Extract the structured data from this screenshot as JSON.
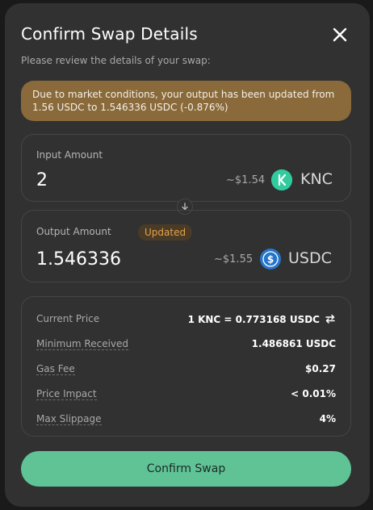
{
  "dialog": {
    "title": "Confirm Swap Details",
    "subtitle": "Please review the details of your swap:",
    "warning": "Due to market conditions, your output has been updated from 1.56 USDC to 1.546336 USDC (-0.876%)"
  },
  "input": {
    "label": "Input Amount",
    "amount": "2",
    "usd": "~$1.54",
    "token": "KNC",
    "token_color": "#31cb9e"
  },
  "output": {
    "label": "Output Amount",
    "badge": "Updated",
    "amount": "1.546336",
    "usd": "~$1.55",
    "token": "USDC",
    "token_color": "#2775ca"
  },
  "details": {
    "current_price_label": "Current Price",
    "current_price_value": "1 KNC = 0.773168 USDC",
    "min_received_label": "Minimum Received",
    "min_received_value": "1.486861 USDC",
    "gas_fee_label": "Gas Fee",
    "gas_fee_value": "$0.27",
    "price_impact_label": "Price Impact",
    "price_impact_value": "< 0.01%",
    "max_slippage_label": "Max Slippage",
    "max_slippage_value": "4%"
  },
  "actions": {
    "confirm_label": "Confirm Swap"
  },
  "colors": {
    "accent": "#5fc396",
    "warning_bg": "#8a6a3a",
    "badge_text": "#e3a24a"
  },
  "icons": [
    "close-icon",
    "arrow-down-icon",
    "knc-token-icon",
    "usdc-token-icon",
    "swap-direction-icon"
  ]
}
